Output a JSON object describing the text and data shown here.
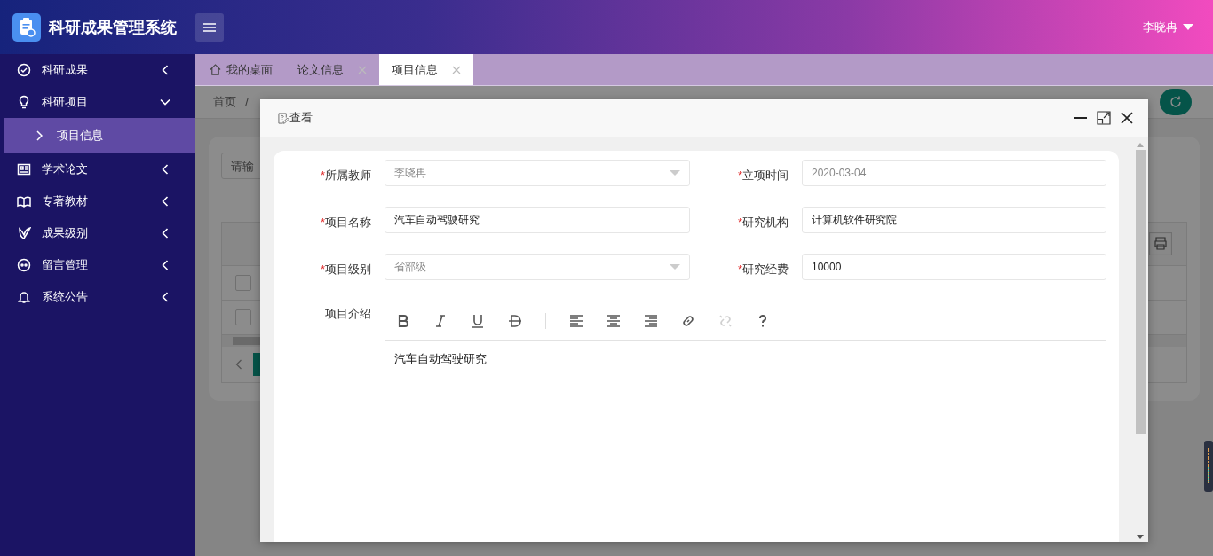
{
  "header": {
    "title": "科研成果管理系统",
    "user": "李晓冉"
  },
  "sidebar": {
    "items": [
      {
        "label": "科研成果",
        "expanded": false
      },
      {
        "label": "科研项目",
        "expanded": true,
        "children": [
          {
            "label": "项目信息",
            "selected": true
          }
        ]
      },
      {
        "label": "学术论文",
        "expanded": false
      },
      {
        "label": "专著教材",
        "expanded": false
      },
      {
        "label": "成果级别",
        "expanded": false
      },
      {
        "label": "留言管理",
        "expanded": false
      },
      {
        "label": "系统公告",
        "expanded": false
      }
    ]
  },
  "tabs": [
    {
      "label": "我的桌面",
      "selected": false,
      "closable": false
    },
    {
      "label": "论文信息",
      "selected": false,
      "closable": true
    },
    {
      "label": "项目信息",
      "selected": true,
      "closable": true
    }
  ],
  "page": {
    "breadcrumb": "首页",
    "separator": "/",
    "search": {
      "placeholder": "请输"
    },
    "table": {
      "rows": [
        {
          "checked": false
        },
        {
          "checked": false
        }
      ]
    }
  },
  "modal": {
    "title": "查看",
    "fields": [
      {
        "label": "所属教师",
        "required_mark": "*",
        "kind": "select",
        "value": "李晓冉",
        "disabled": true
      },
      {
        "label": "立项时间",
        "required_mark": "*",
        "kind": "input",
        "value": "2020-03-04",
        "disabled": true
      },
      {
        "label": "项目名称",
        "required_mark": "*",
        "kind": "input",
        "value": "汽车自动驾驶研究",
        "disabled": false
      },
      {
        "label": "研究机构",
        "required_mark": "*",
        "kind": "input",
        "value": "计算机软件研究院",
        "disabled": false
      },
      {
        "label": "项目级别",
        "required_mark": "*",
        "kind": "select",
        "value": "省部级",
        "disabled": true
      },
      {
        "label": "研究经费",
        "required_mark": "*",
        "kind": "input",
        "value": "10000",
        "disabled": false
      }
    ],
    "editor": {
      "label": "项目介绍",
      "content": "汽车自动驾驶研究",
      "tools": [
        {
          "kind": "bold",
          "disabled": false
        },
        {
          "kind": "italic",
          "disabled": false
        },
        {
          "kind": "underline",
          "disabled": false
        },
        {
          "kind": "strike",
          "disabled": false
        },
        {
          "kind": "divider"
        },
        {
          "kind": "align-left",
          "disabled": false
        },
        {
          "kind": "align-center",
          "disabled": false
        },
        {
          "kind": "align-right",
          "disabled": false
        },
        {
          "kind": "link",
          "disabled": false
        },
        {
          "kind": "unlink",
          "disabled": true
        },
        {
          "kind": "help",
          "disabled": false
        }
      ]
    }
  }
}
